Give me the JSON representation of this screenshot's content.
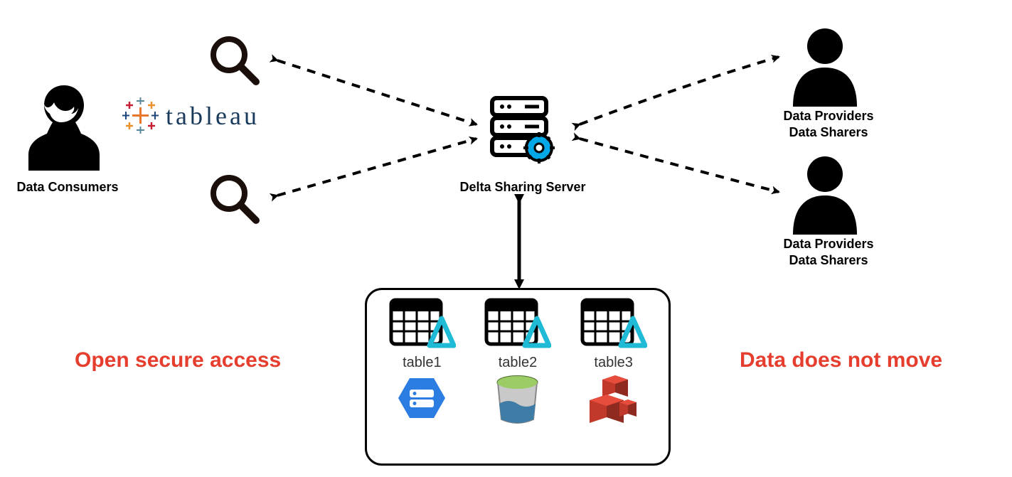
{
  "consumers": {
    "label": "Data Consumers"
  },
  "tableau": {
    "name": "tableau"
  },
  "server": {
    "label": "Delta Sharing Server"
  },
  "provider1": {
    "line1": "Data Providers",
    "line2": "Data Sharers"
  },
  "provider2": {
    "line1": "Data Providers",
    "line2": "Data Sharers"
  },
  "callouts": {
    "left": "Open secure access",
    "right": "Data does not move"
  },
  "tables": {
    "t1": "table1",
    "t2": "table2",
    "t3": "table3"
  },
  "colors": {
    "accent_red": "#e63e2e",
    "accent_blue": "#00a8e8",
    "tableau_blue": "#1a3a5c"
  }
}
